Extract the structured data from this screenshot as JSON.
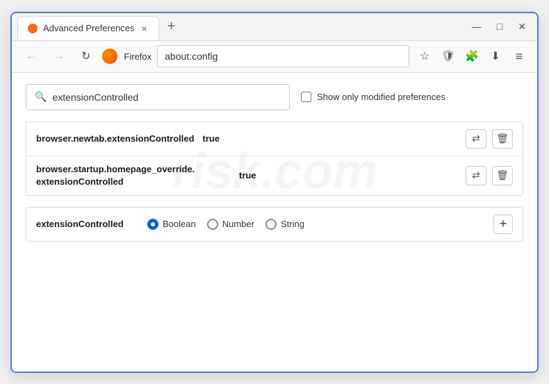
{
  "tab": {
    "title": "Advanced Preferences",
    "close_label": "×"
  },
  "new_tab_btn": "+",
  "window_controls": {
    "minimize": "—",
    "maximize": "□",
    "close": "✕"
  },
  "nav": {
    "back": "←",
    "forward": "→",
    "reload": "↻",
    "browser_name": "Firefox",
    "address": "about:config"
  },
  "nav_icons": {
    "bookmark": "☆",
    "shield": "🛡",
    "extension": "🧩",
    "download": "⬇",
    "menu": "≡"
  },
  "search": {
    "placeholder": "",
    "value": "extensionControlled",
    "show_modified_label": "Show only modified preferences"
  },
  "prefs": [
    {
      "name": "browser.newtab.extensionControlled",
      "value": "true"
    },
    {
      "name_line1": "browser.startup.homepage_override.",
      "name_line2": "extensionControlled",
      "value": "true"
    }
  ],
  "new_pref": {
    "name": "extensionControlled",
    "types": [
      "Boolean",
      "Number",
      "String"
    ]
  },
  "actions": {
    "toggle": "⇄",
    "delete": "🗑",
    "add": "+"
  },
  "watermark": "risk.com"
}
